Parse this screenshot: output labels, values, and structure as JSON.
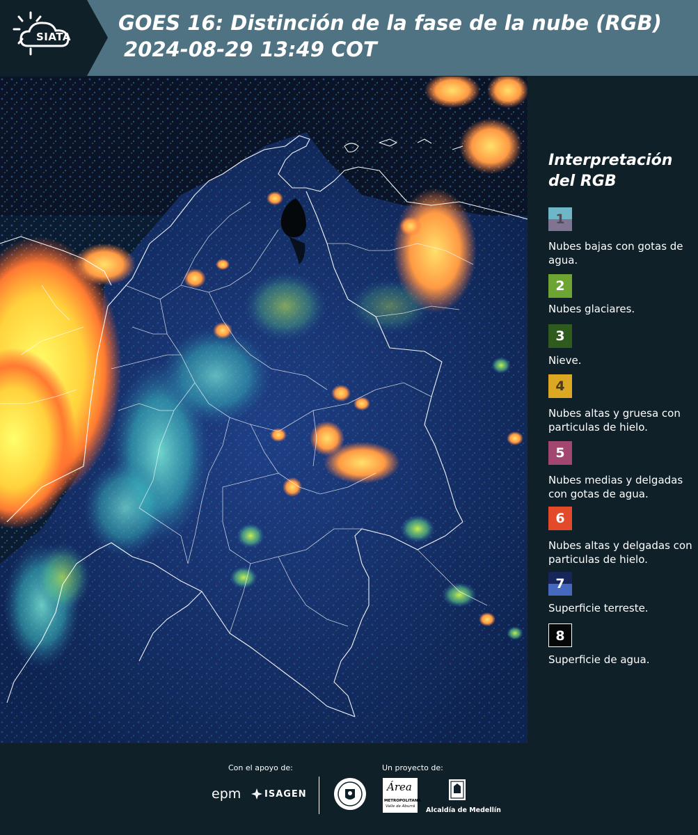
{
  "header": {
    "logo_text": "SIATA",
    "title_line1": "GOES 16: Distinción de la fase de la nube (RGB)",
    "title_line2": "2024-08-29 13:49 COT"
  },
  "legend": {
    "title_line1": "Interpretación",
    "title_line2": "del RGB",
    "items": [
      {
        "number": "1",
        "label": "Nubes bajas con gotas de agua.",
        "color_top": "#6fb6c6",
        "color_bottom": "#7f7592"
      },
      {
        "number": "2",
        "label": "Nubes glaciares.",
        "color_top": "#6ea431",
        "color_bottom": "#6ea431"
      },
      {
        "number": "3",
        "label": "Nieve.",
        "color_top": "#2f5b1e",
        "color_bottom": "#2f5b1e"
      },
      {
        "number": "4",
        "label": "Nubes altas y gruesa con particulas de hielo.",
        "color_top": "#dca823",
        "color_bottom": "#dca823"
      },
      {
        "number": "5",
        "label": "Nubes medias y delgadas con gotas de agua.",
        "color_top": "#a2476f",
        "color_bottom": "#a2476f"
      },
      {
        "number": "6",
        "label": "Nubes altas y delgadas con particulas de hielo.",
        "color_top": "#e34a2a",
        "color_bottom": "#e34a2a"
      },
      {
        "number": "7",
        "label": "Superficie terreste.",
        "color_top": "#16255a",
        "color_bottom": "#4469bf"
      },
      {
        "number": "8",
        "label": "Superficie de agua.",
        "color_top": "#050808",
        "color_bottom": "#050808"
      }
    ]
  },
  "footer": {
    "support_label": "Con el apoyo de:",
    "project_label": "Un proyecto de:",
    "sponsor_1": "epm",
    "sponsor_2": "ISAGEN",
    "partner_1_line1": "Área",
    "partner_1_line2": "METROPOLITANA",
    "partner_1_line3": "Valle de Aburrá",
    "partner_2": "Alcaldía de Medellín"
  }
}
